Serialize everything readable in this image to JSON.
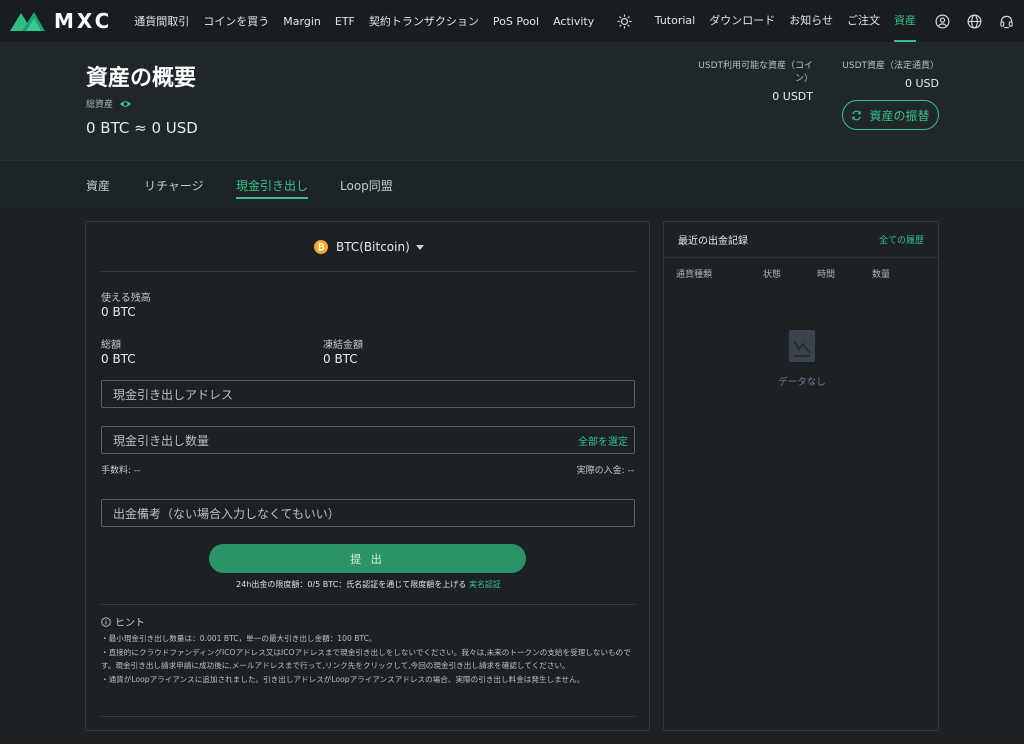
{
  "brand": {
    "name": "MXC",
    "accent": "#3bbf8a"
  },
  "nav": {
    "left": [
      "通貨間取引",
      "コインを買う",
      "Margin",
      "ETF",
      "契約トランザクション",
      "PoS Pool",
      "Activity"
    ],
    "right": [
      "Tutorial",
      "ダウンロード",
      "お知らせ",
      "ご注文",
      "資産"
    ],
    "active": "資産",
    "icons": [
      "theme-sun-icon",
      "user-icon",
      "globe-icon",
      "support-icon"
    ]
  },
  "summary": {
    "title": "資産の概要",
    "total_label": "総資産",
    "total_value": "0 BTC ≈ 0 USD",
    "usdt_coin_label": "USDT利用可能な資産（コイン）",
    "usdt_coin_value": "0 USDT",
    "usdt_fiat_label": "USDT資産（法定通貨）",
    "usdt_fiat_value": "0 USD",
    "transfer_button": "資産の振替"
  },
  "tabs": [
    "資産",
    "リチャージ",
    "現金引き出し",
    "Loop同盟"
  ],
  "active_tab": "現金引き出し",
  "withdraw": {
    "coin": "BTC(Bitcoin)",
    "available_label": "使える残高",
    "available_value": "0 BTC",
    "total_label": "総額",
    "total_value": "0 BTC",
    "frozen_label": "凍結金額",
    "frozen_value": "0 BTC",
    "address_placeholder": "現金引き出しアドレス",
    "amount_placeholder": "現金引き出し数量",
    "select_all": "全部を選定",
    "fee_label": "手数料: --",
    "actual_label": "実際の入金: --",
    "memo_placeholder": "出金備考（ない場合入力しなくてもいい）",
    "submit": "提 出",
    "limit_text": "24h出金の限度額：0/5 BTC：氏名認証を通じて限度額を上げる",
    "limit_link": "実名認証",
    "hint_title": "ヒント",
    "hints": [
      "・最小現金引き出し数量は：0.001 BTC，単一の最大引き出し金額：100 BTC。",
      "・直接的にクラウドファンディングICOアドレス又はICOアドレスまで現金引き出しをしないでください。我々は,未来のトークンの支給を受理しないものです。現金引き出し請求申請に成功後に,メールアドレスまで行って,リンク先をクリックして,今回の現金引き出し請求を確認してください。",
      "・通貨がLoopアライアンスに追加されました。引き出しアドレスがLoopアライアンスアドレスの場合、実際の引き出し料金は発生しません。"
    ]
  },
  "records": {
    "title": "最近の出金記録",
    "all_link": "全ての履歴",
    "columns": [
      "通貨種類",
      "状態",
      "時間",
      "数量"
    ],
    "empty": "データなし"
  }
}
